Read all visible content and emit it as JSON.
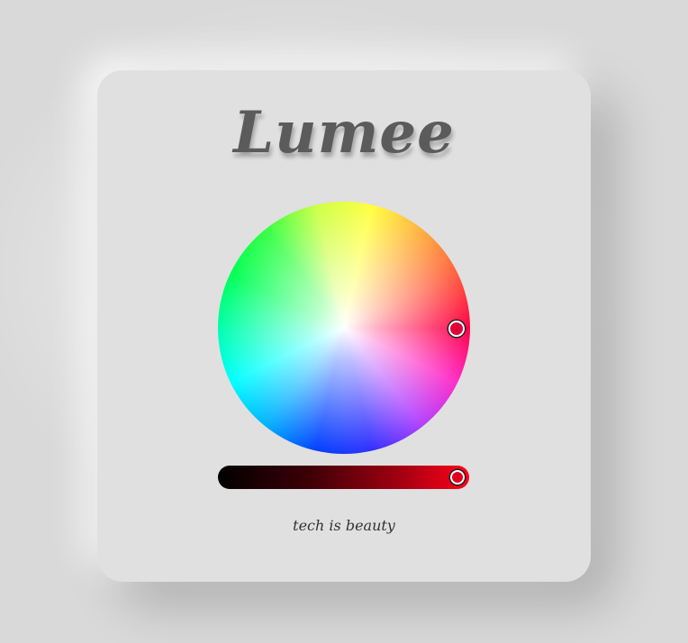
{
  "app": {
    "logo_text": "Lumee",
    "tagline": "tech is beauty"
  },
  "color_picker": {
    "selected_color": "#ff0044",
    "hue_degrees": 345,
    "saturation": 1.0,
    "brightness": 1.0
  },
  "brightness_slider": {
    "value": 1.0,
    "start_color": "#000000",
    "end_color": "#ff0019"
  },
  "theme": {
    "card_color": "#e0e0e0",
    "logo_color": "#5b5b5b",
    "tagline_color": "#333333"
  }
}
